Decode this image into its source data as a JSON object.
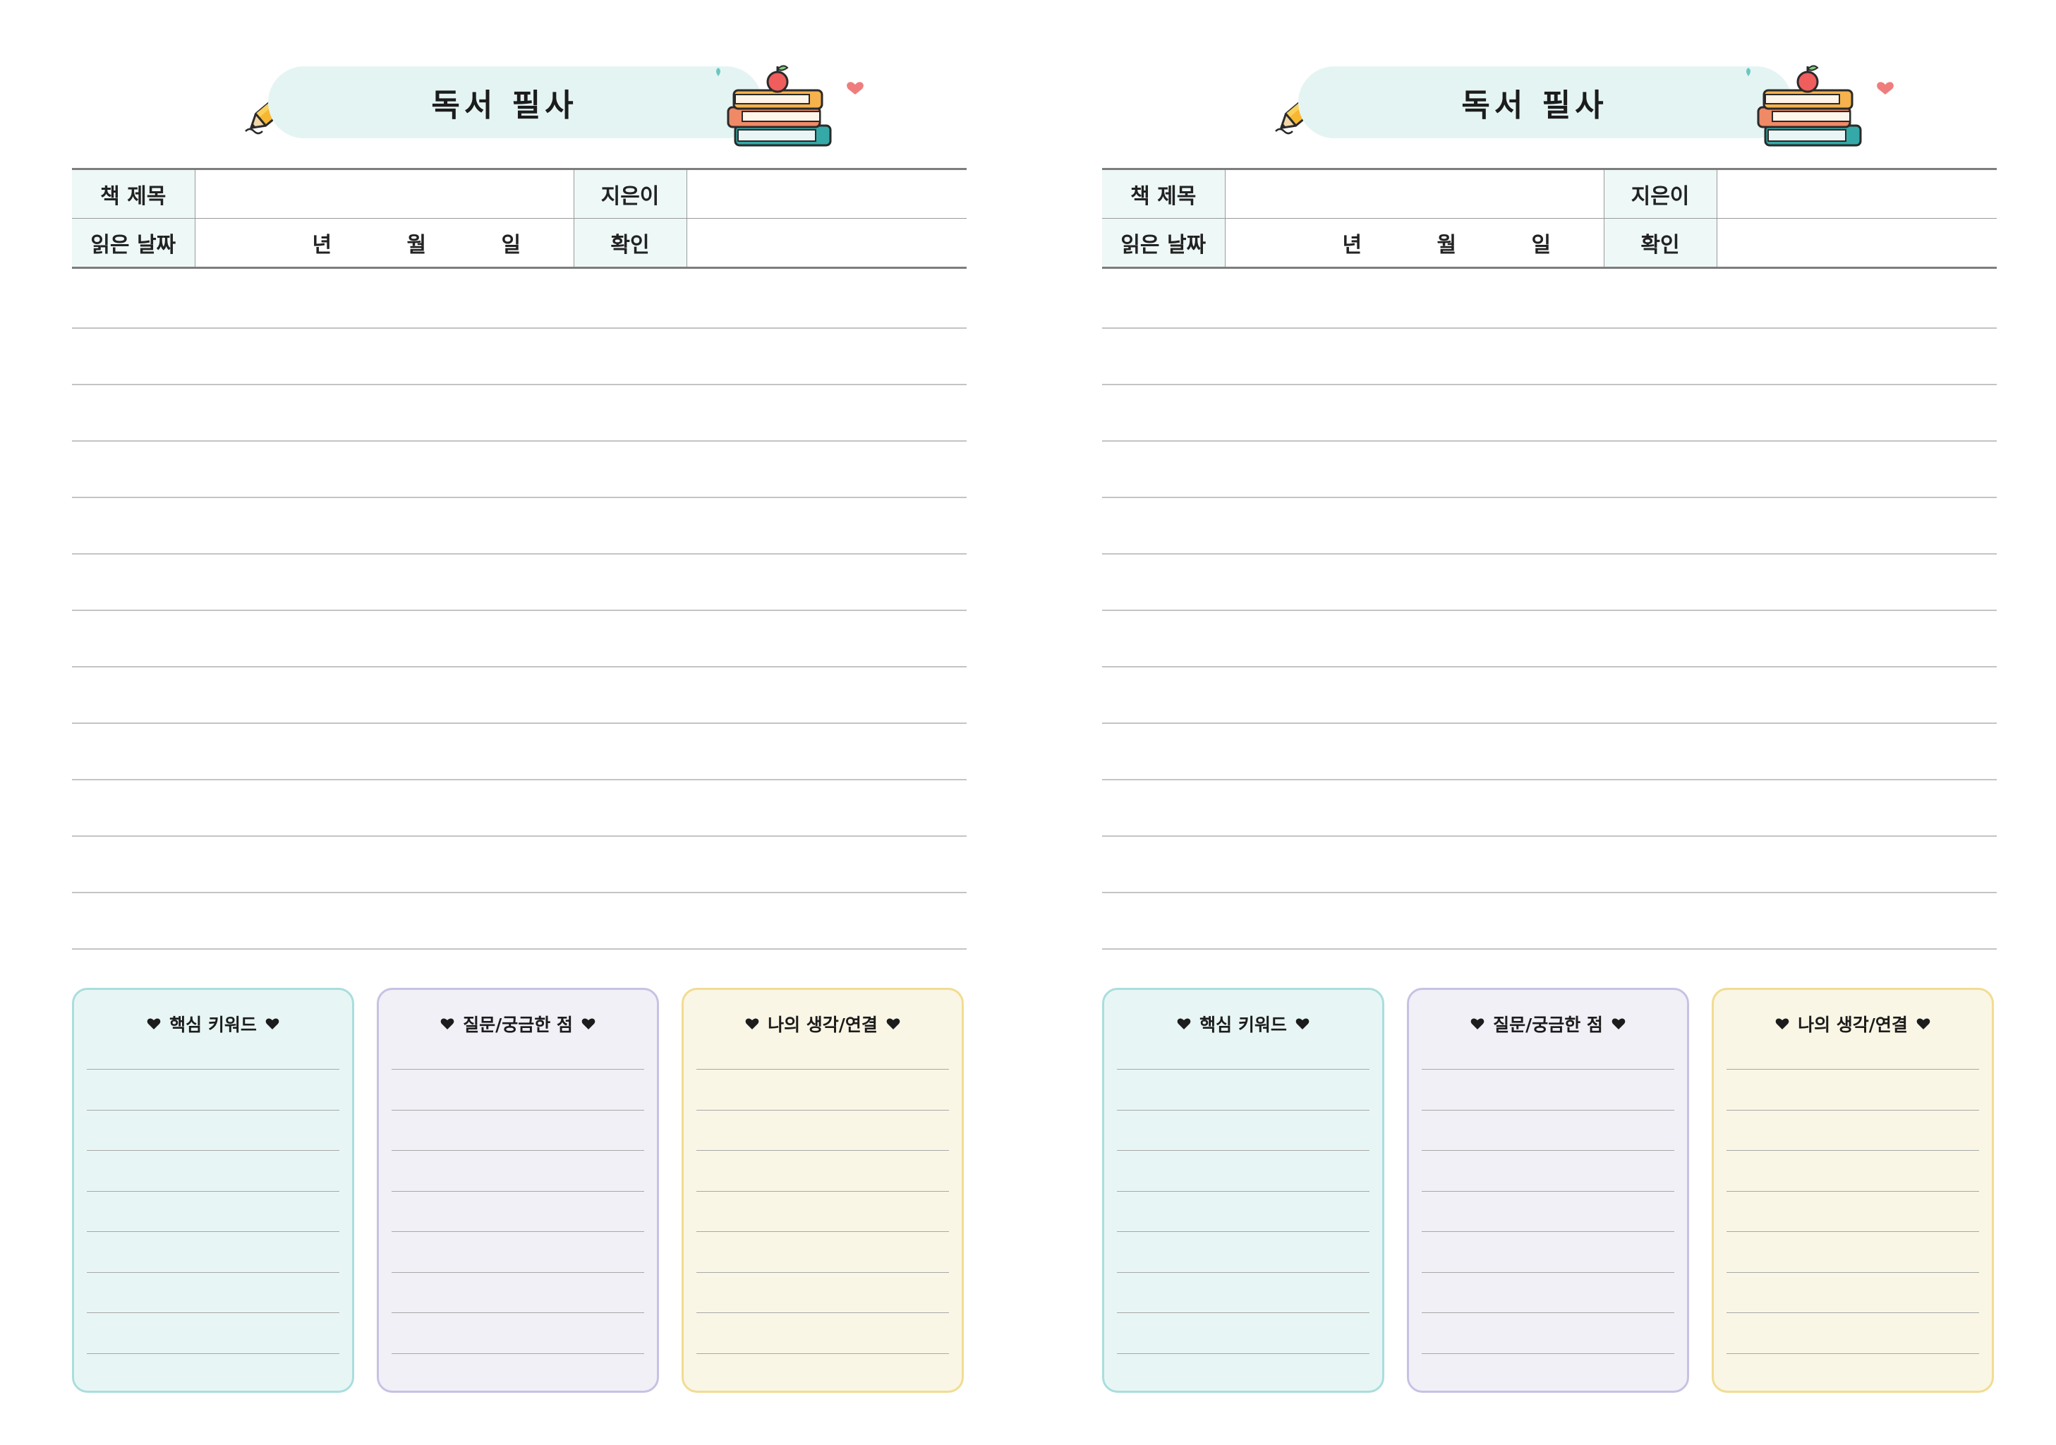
{
  "pages": [
    {
      "title": "독서 필사",
      "fields": {
        "book_title_label": "책 제목",
        "author_label": "지은이",
        "date_label": "읽은 날짜",
        "confirm_label": "확인",
        "year": "년",
        "month": "월",
        "day": "일"
      },
      "boxes": [
        {
          "heading": "핵심 키워드"
        },
        {
          "heading": "질문/궁금한 점"
        },
        {
          "heading": "나의 생각/연결"
        }
      ]
    },
    {
      "title": "독서 필사",
      "fields": {
        "book_title_label": "책 제목",
        "author_label": "지은이",
        "date_label": "읽은 날짜",
        "confirm_label": "확인",
        "year": "년",
        "month": "월",
        "day": "일"
      },
      "boxes": [
        {
          "heading": "핵심 키워드"
        },
        {
          "heading": "질문/궁금한 점"
        },
        {
          "heading": "나의 생각/연결"
        }
      ]
    }
  ],
  "colors": {
    "banner": "#e4f4f3",
    "keyword_box": "#e7f6f4",
    "question_box": "#f1f0f7",
    "thought_box": "#faf6e5"
  },
  "icons": [
    "pencil-icon",
    "book-stack-icon",
    "heart-icon"
  ]
}
